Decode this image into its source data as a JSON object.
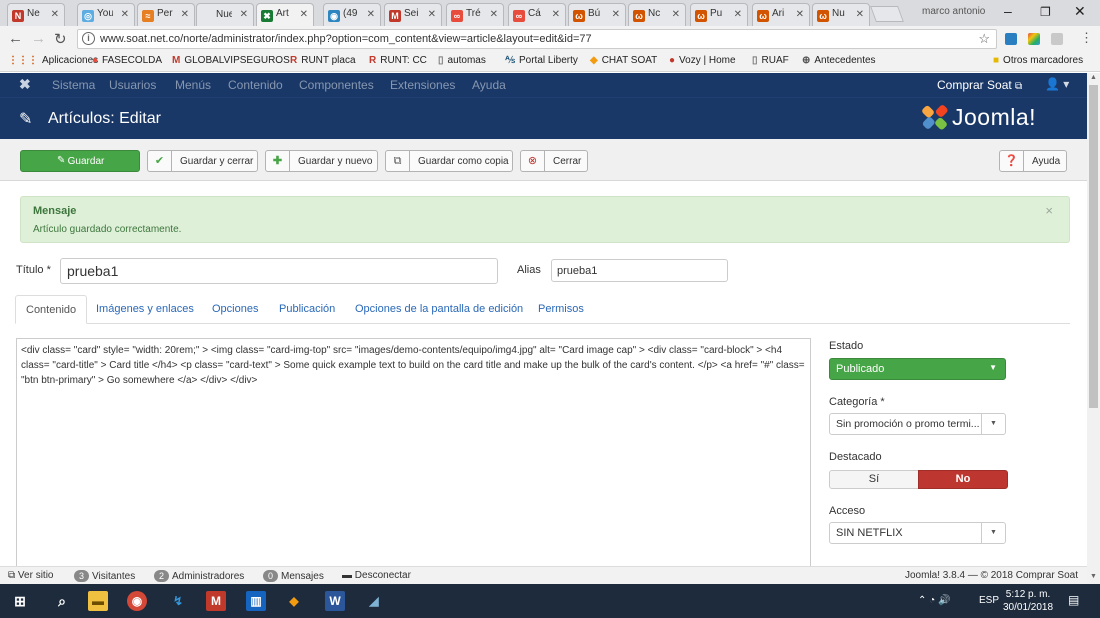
{
  "browser": {
    "tabs": [
      {
        "label": "Ne",
        "fav": "N",
        "color": "#c0392b"
      },
      {
        "label": "You",
        "fav": "◎",
        "color": "#5dade2"
      },
      {
        "label": "Per",
        "fav": "≈",
        "color": "#e67e22"
      },
      {
        "label": "Nueva",
        "fav": "",
        "color": "#e6e7ea"
      },
      {
        "label": "Art",
        "fav": "✖",
        "color": "#1a7b34"
      },
      {
        "label": "(49",
        "fav": "◉",
        "color": "#2e86c1"
      },
      {
        "label": "Sei",
        "fav": "M",
        "color": "#c0392b"
      },
      {
        "label": "Tré",
        "fav": "∞",
        "color": "#e74c3c"
      },
      {
        "label": "Cá",
        "fav": "∞",
        "color": "#e74c3c"
      },
      {
        "label": "Bú",
        "fav": "ω",
        "color": "#d35400"
      },
      {
        "label": "Nc",
        "fav": "ω",
        "color": "#d35400"
      },
      {
        "label": "Pu",
        "fav": "ω",
        "color": "#d35400"
      },
      {
        "label": "Ari",
        "fav": "ω",
        "color": "#d35400"
      },
      {
        "label": "Nu",
        "fav": "ω",
        "color": "#d35400"
      }
    ],
    "user": "marco antonio",
    "url": "www.soat.net.co/norte/administrator/index.php?option=com_content&view=article&layout=edit&id=77",
    "bookmarks": [
      "Aplicaciones",
      "FASECOLDA",
      "GLOBALVIPSEGUROS",
      "RUNT placa",
      "RUNT: CC",
      "automas",
      "Portal Liberty",
      "CHAT SOAT",
      "Vozy | Home",
      "RUAF",
      "Antecedentes",
      "Otros marcadores"
    ]
  },
  "joomla": {
    "menu": [
      "Sistema",
      "Usuarios",
      "Menús",
      "Contenido",
      "Componentes",
      "Extensiones",
      "Ayuda"
    ],
    "site_link": "Comprar Soat",
    "page_title": "Artículos: Editar",
    "brand": "Joomla!",
    "toolbar": {
      "save": "Guardar",
      "save_close": "Guardar y cerrar",
      "save_new": "Guardar y nuevo",
      "save_copy": "Guardar como copia",
      "close": "Cerrar",
      "help": "Ayuda"
    },
    "message": {
      "heading": "Mensaje",
      "body": "Artículo guardado correctamente."
    },
    "title_label": "Título *",
    "title_value": "prueba1",
    "alias_label": "Alias",
    "alias_value": "prueba1",
    "tabs": [
      "Contenido",
      "Imágenes y enlaces",
      "Opciones",
      "Publicación",
      "Opciones de la pantalla de edición",
      "Permisos"
    ],
    "editor_content": "<div class= \"card\" style= \"width: 20rem;\" > <img class= \"card-img-top\" src= \"images/demo-contents/equipo/img4.jpg\" alt= \"Card image cap\" > <div class= \"card-block\" > <h4 class= \"card-title\" > Card title </h4> <p class= \"card-text\" > Some quick example text to build on the card title and make up the bulk of the card's content. </p> <a href= \"#\" class= \"btn btn-primary\" > Go somewhere </a> </div> </div>",
    "sidebar": {
      "estado_label": "Estado",
      "estado_value": "Publicado",
      "categoria_label": "Categoría *",
      "categoria_value": "Sin promoción o promo termi...",
      "destacado_label": "Destacado",
      "destacado_yes": "Sí",
      "destacado_no": "No",
      "acceso_label": "Acceso",
      "acceso_value": "SIN NETFLIX"
    },
    "statusbar": {
      "ver_sitio": "Ver sitio",
      "visitantes_count": "3",
      "visitantes": "Visitantes",
      "admins_count": "2",
      "admins": "Administradores",
      "mensajes_count": "0",
      "mensajes": "Mensajes",
      "desconectar": "Desconectar",
      "version": "Joomla! 3.8.4 — © 2018 Comprar Soat"
    }
  },
  "taskbar": {
    "lang": "ESP",
    "time": "5:12 p. m.",
    "date": "30/01/2018"
  },
  "colors": {
    "joomla_nav": "#1a3867",
    "success_green": "#46a546",
    "danger_red": "#bd362f",
    "alert_bg": "#dff0d8"
  }
}
